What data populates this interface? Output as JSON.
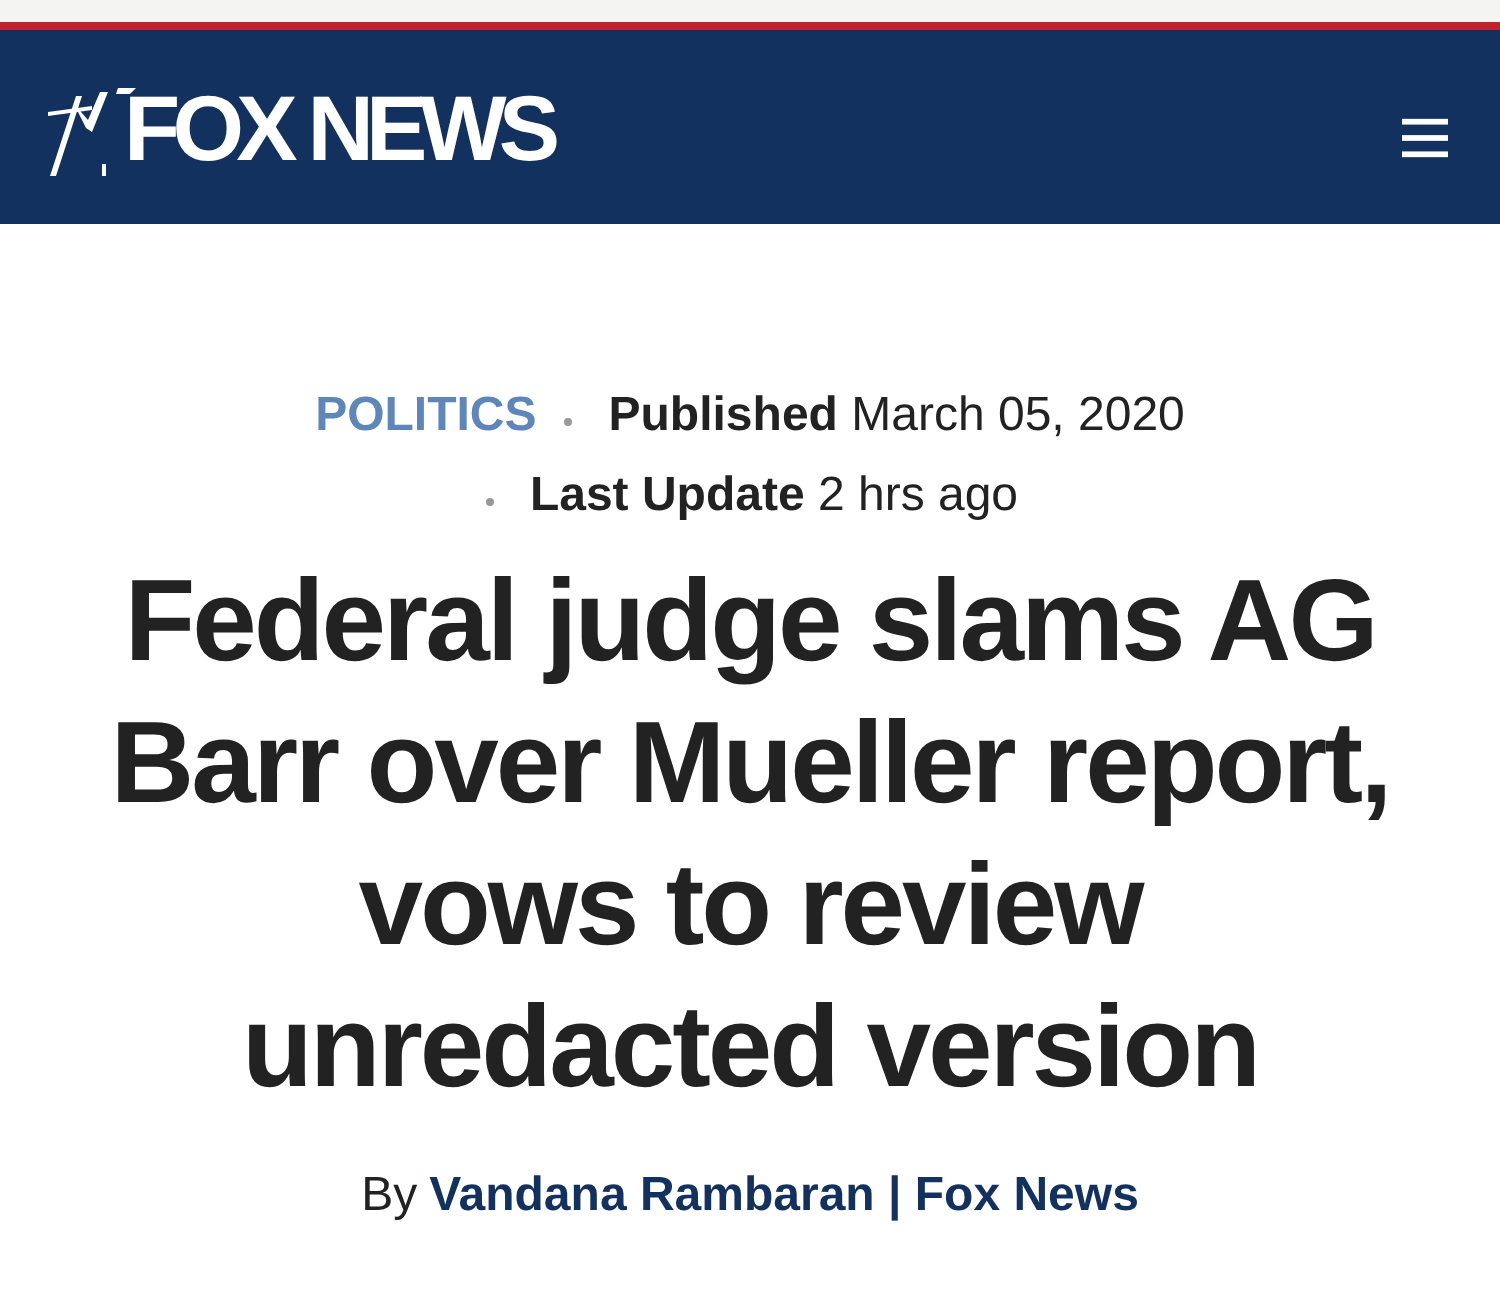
{
  "header": {
    "logo": {
      "text": "FOX NEWS"
    }
  },
  "article": {
    "category": "POLITICS",
    "published": {
      "label": "Published",
      "value": "March 05, 2020"
    },
    "updated": {
      "label": "Last Update",
      "value": "2 hrs ago"
    },
    "headline": "Federal judge slams AG Barr over Mueller report, vows to review unredacted version",
    "byline": {
      "prefix": "By",
      "author": "Vandana Rambaran | Fox News"
    }
  }
}
